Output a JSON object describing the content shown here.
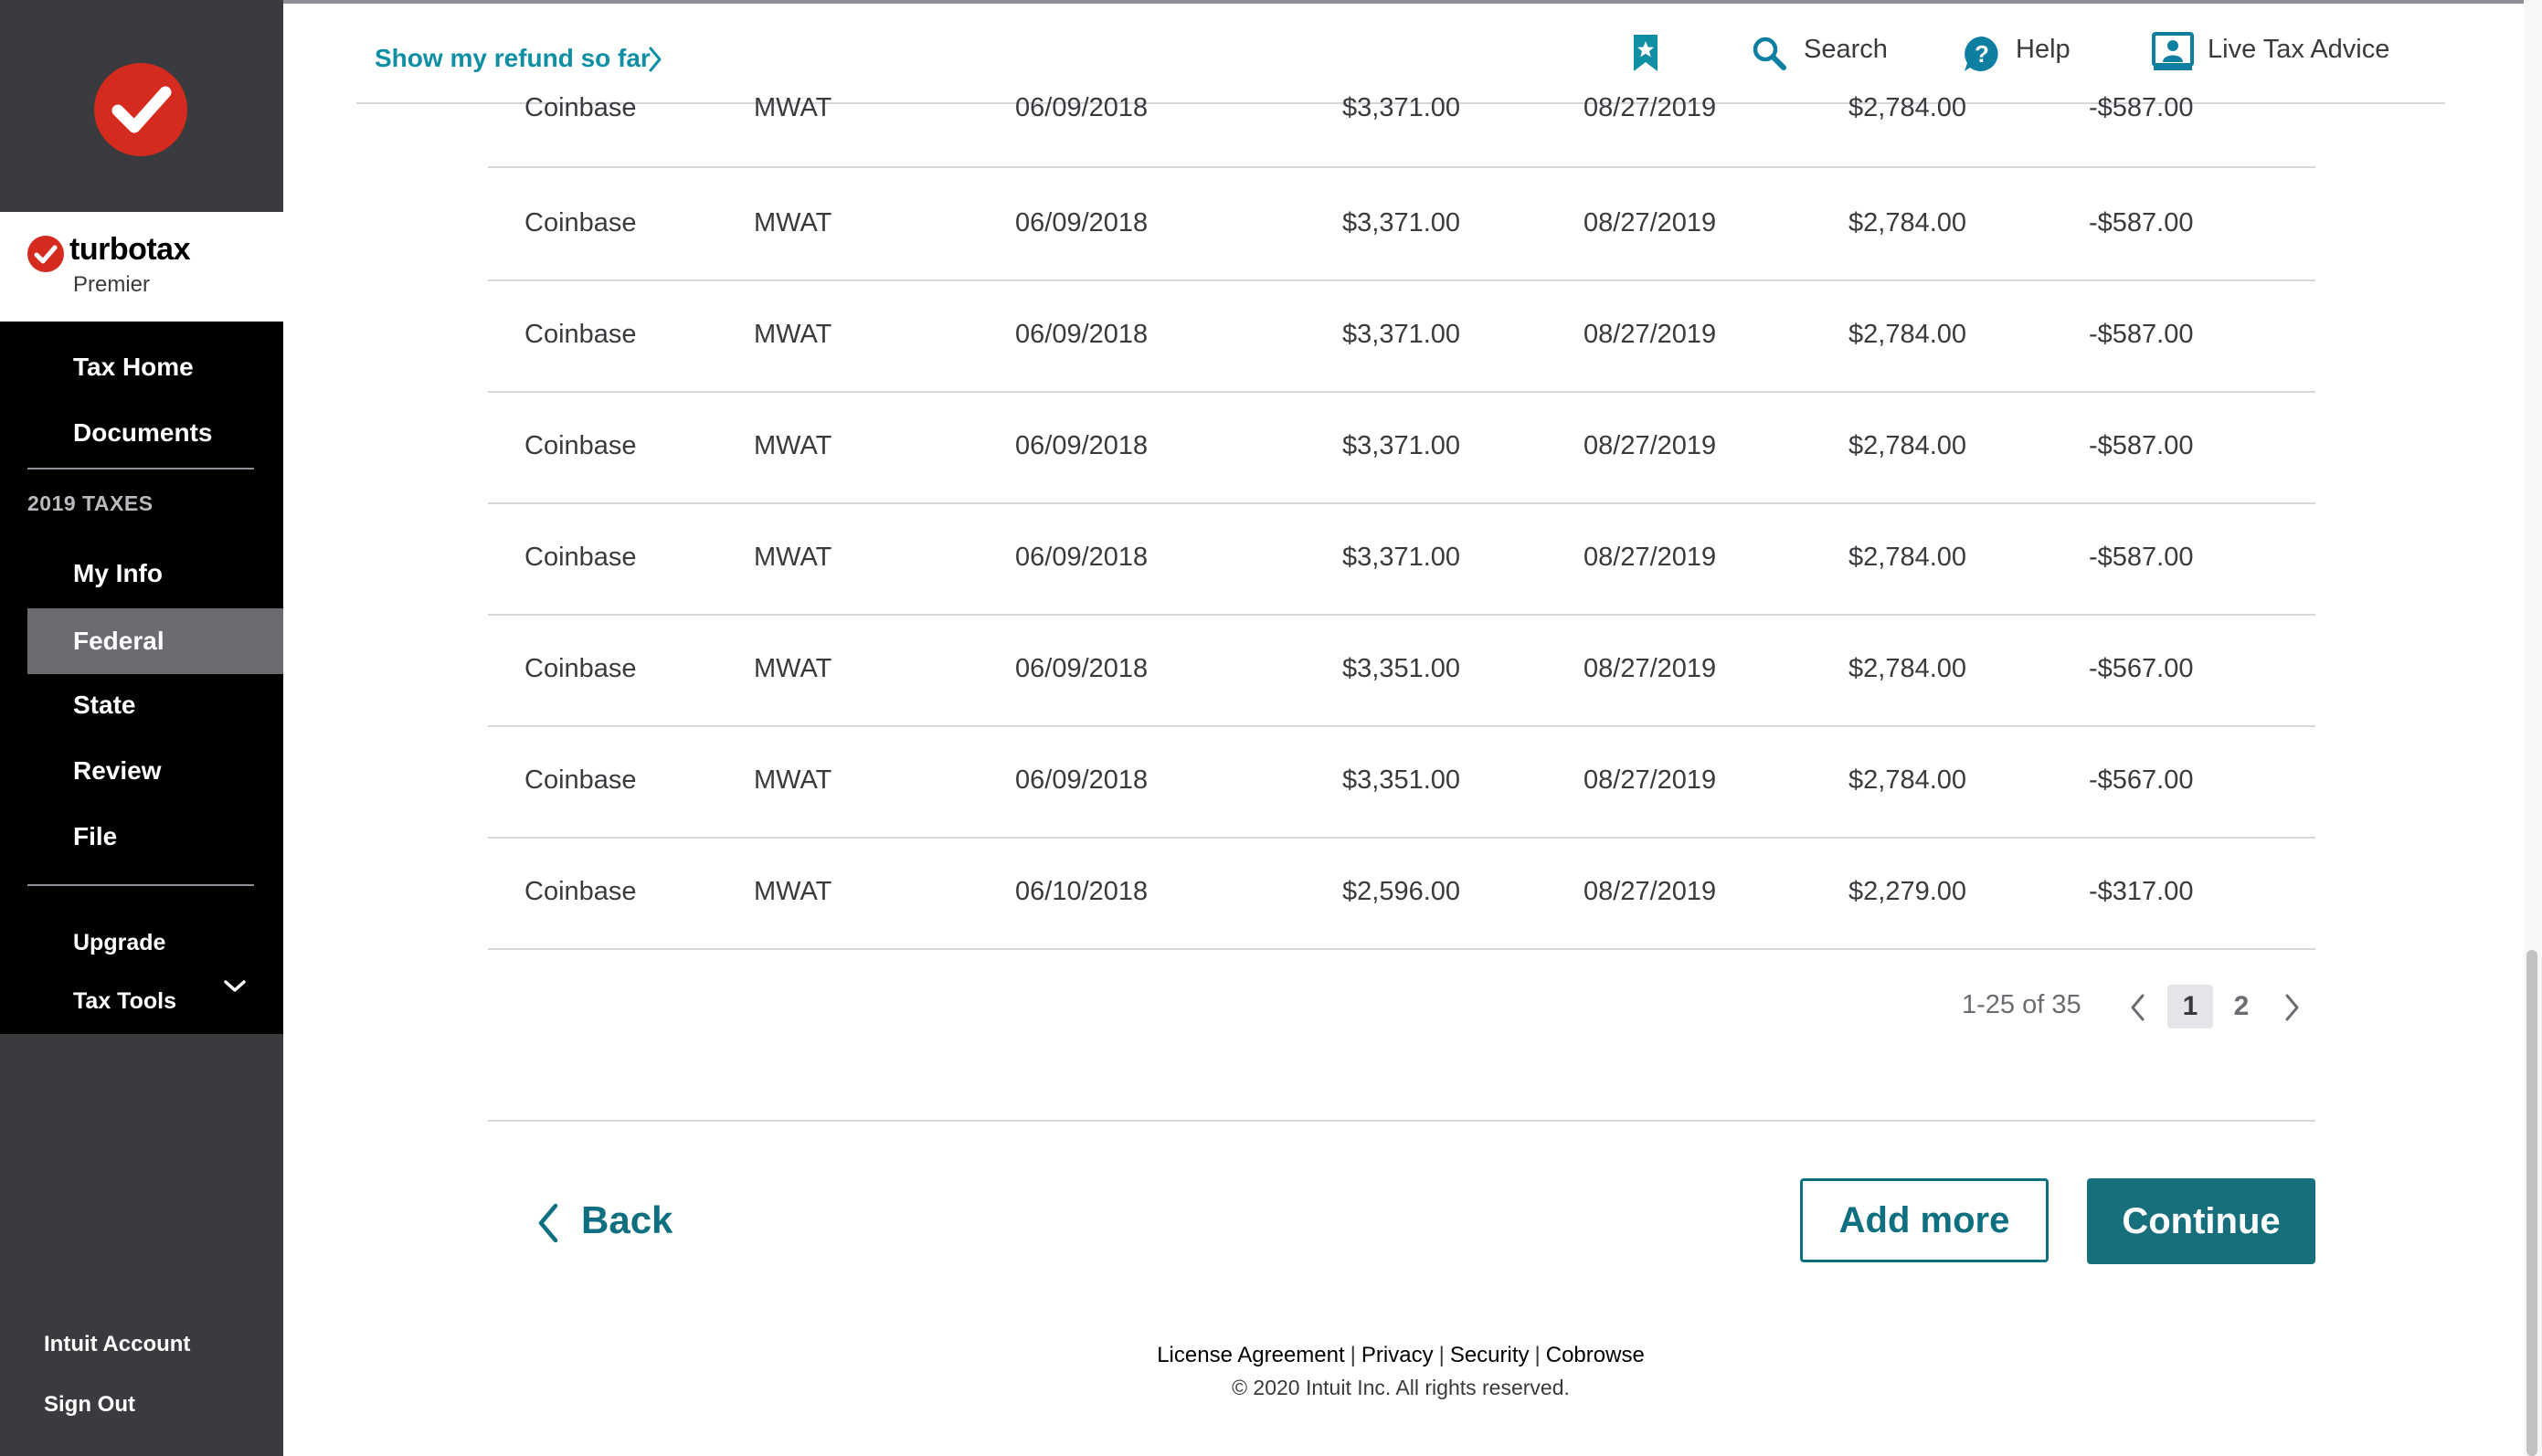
{
  "sidebar": {
    "brand_name": "turbotax",
    "edition": "Premier",
    "nav": {
      "tax_home": "Tax Home",
      "documents": "Documents",
      "section_title": "2019 TAXES",
      "my_info": "My Info",
      "federal": "Federal",
      "state": "State",
      "review": "Review",
      "file": "File",
      "upgrade": "Upgrade",
      "tax_tools": "Tax Tools"
    },
    "account": {
      "intuit_account": "Intuit Account",
      "sign_out": "Sign Out"
    }
  },
  "header": {
    "refund_link": "Show my refund so far",
    "search": "Search",
    "help": "Help",
    "live_advice": "Live Tax Advice"
  },
  "table": {
    "rows": [
      [
        "Coinbase",
        "MWAT",
        "06/09/2018",
        "$3,371.00",
        "08/27/2019",
        "$2,784.00",
        "-$587.00"
      ],
      [
        "Coinbase",
        "MWAT",
        "06/09/2018",
        "$3,371.00",
        "08/27/2019",
        "$2,784.00",
        "-$587.00"
      ],
      [
        "Coinbase",
        "MWAT",
        "06/09/2018",
        "$3,371.00",
        "08/27/2019",
        "$2,784.00",
        "-$587.00"
      ],
      [
        "Coinbase",
        "MWAT",
        "06/09/2018",
        "$3,371.00",
        "08/27/2019",
        "$2,784.00",
        "-$587.00"
      ],
      [
        "Coinbase",
        "MWAT",
        "06/09/2018",
        "$3,371.00",
        "08/27/2019",
        "$2,784.00",
        "-$587.00"
      ],
      [
        "Coinbase",
        "MWAT",
        "06/09/2018",
        "$3,351.00",
        "08/27/2019",
        "$2,784.00",
        "-$567.00"
      ],
      [
        "Coinbase",
        "MWAT",
        "06/09/2018",
        "$3,351.00",
        "08/27/2019",
        "$2,784.00",
        "-$567.00"
      ],
      [
        "Coinbase",
        "MWAT",
        "06/10/2018",
        "$2,596.00",
        "08/27/2019",
        "$2,279.00",
        "-$317.00"
      ]
    ]
  },
  "pagination": {
    "range": "1-25 of 35",
    "pages": [
      "1",
      "2"
    ],
    "current": "1"
  },
  "actions": {
    "back": "Back",
    "add_more": "Add more",
    "continue": "Continue"
  },
  "footer": {
    "links": [
      "License Agreement",
      "Privacy",
      "Security",
      "Cobrowse"
    ],
    "separator": "|",
    "copyright": "© 2020 Intuit Inc. All rights reserved."
  },
  "colors": {
    "brand_red": "#d52b1e",
    "link_teal": "#0e8fa4",
    "primary_button": "#176f7c",
    "sidebar_dark": "#3a3b3e",
    "nav_black": "#000000",
    "nav_active": "#6b6c72"
  },
  "icons": {
    "logo": "checkmark-circle-icon",
    "bookmark": "bookmark-star-icon",
    "search": "search-icon",
    "help": "help-question-icon",
    "live_advice": "live-advice-person-icon",
    "tax_tools_expand": "chevron-down-icon"
  }
}
